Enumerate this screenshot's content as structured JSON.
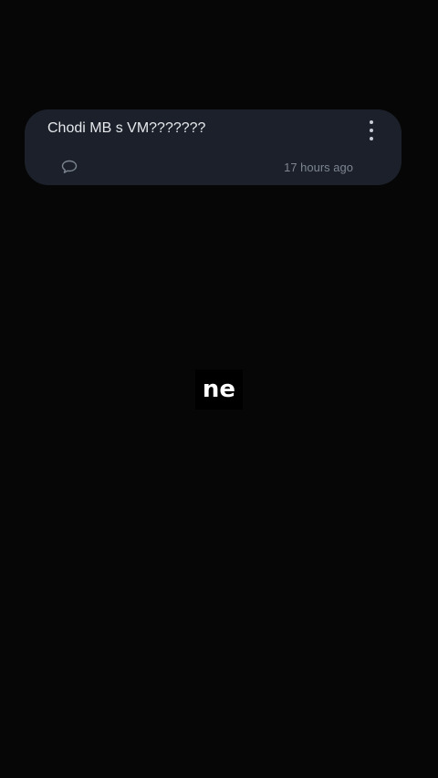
{
  "comment": {
    "text": "Chodi MB s VM???????",
    "timestamp": "17 hours ago",
    "reply_icon": "speech-bubble-icon",
    "more_icon": "more-vertical-icon"
  },
  "caption": {
    "word": "ne"
  },
  "colors": {
    "background": "#060606",
    "card": "#1b202a",
    "text": "#e6e8ec",
    "muted_text": "#7d8591"
  }
}
